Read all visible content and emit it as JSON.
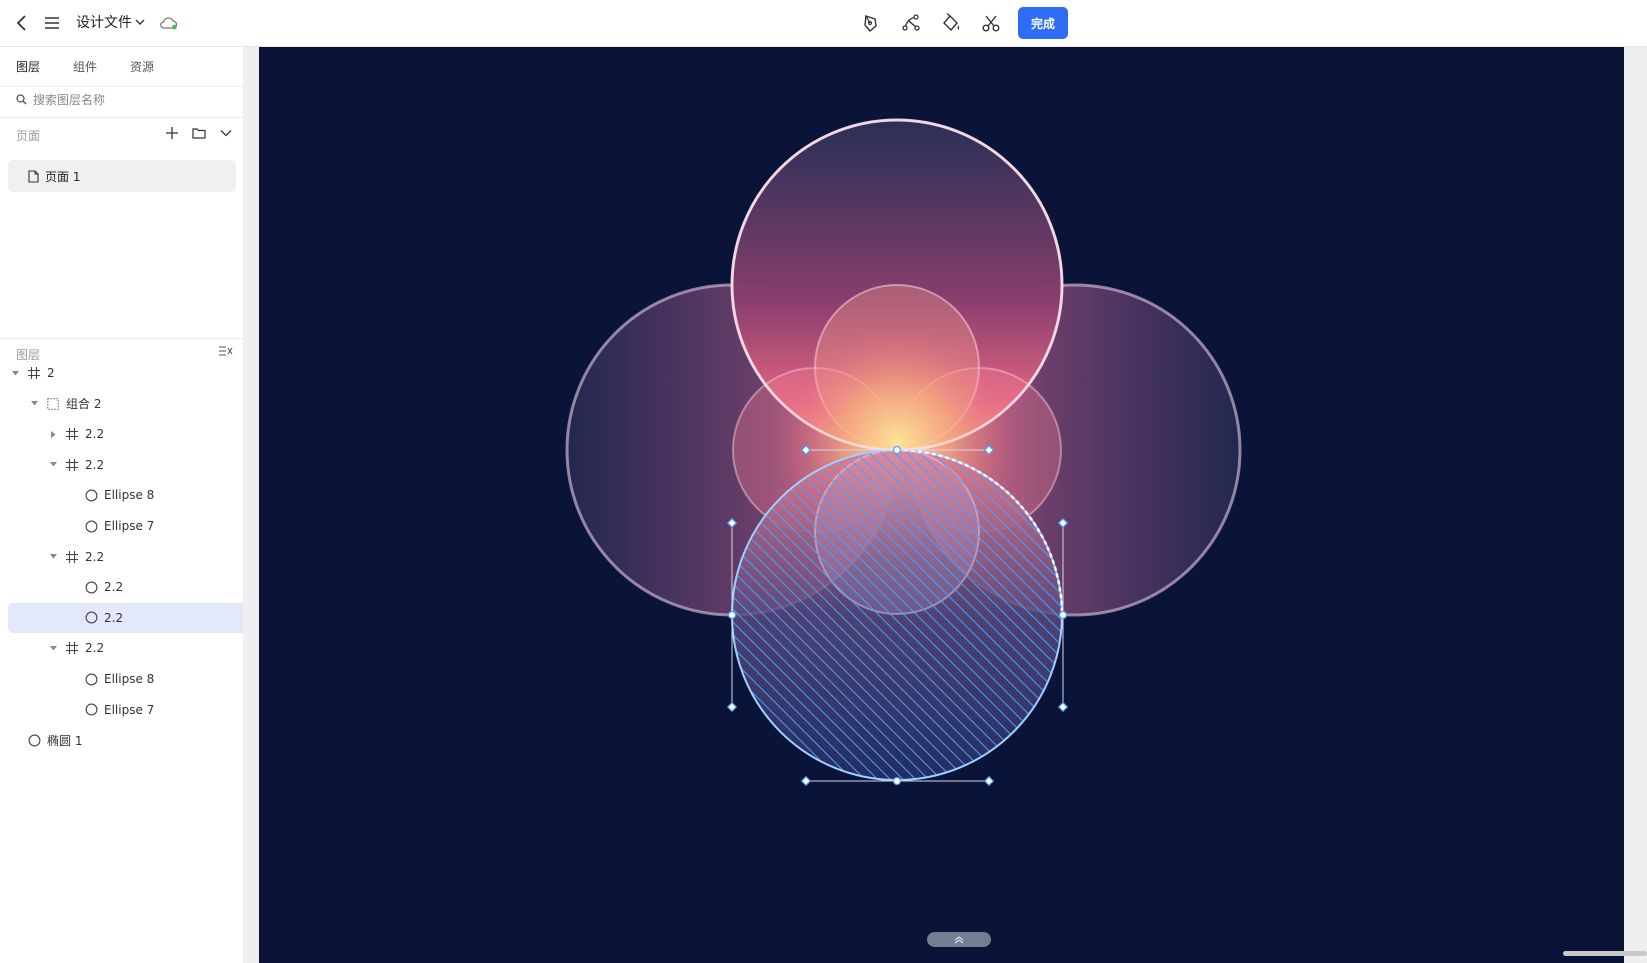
{
  "header": {
    "file_title": "设计文件",
    "done_label": "完成",
    "icons": [
      "back-arrow-icon",
      "menu-icon",
      "chevron-down-icon",
      "cloud-sync-icon",
      "pen-tool-icon",
      "vector-path-icon",
      "paint-bucket-icon",
      "scissors-icon"
    ]
  },
  "sidebar": {
    "tabs": [
      {
        "label": "图层"
      },
      {
        "label": "组件"
      },
      {
        "label": "资源"
      }
    ],
    "search_placeholder": "搜索图层名称",
    "pages_label": "页面",
    "pages": [
      {
        "label": "页面 1"
      }
    ],
    "layers_label": "图层",
    "layers": [
      {
        "label": "2",
        "icon": "frame",
        "depth": 0,
        "caret": "down"
      },
      {
        "label": "组合 2",
        "icon": "group",
        "depth": 1,
        "caret": "down"
      },
      {
        "label": "2.2",
        "icon": "frame",
        "depth": 2,
        "caret": "right"
      },
      {
        "label": "2.2",
        "icon": "frame",
        "depth": 2,
        "caret": "down"
      },
      {
        "label": "Ellipse 8",
        "icon": "ellipse",
        "depth": 3,
        "caret": "none"
      },
      {
        "label": "Ellipse 7",
        "icon": "ellipse",
        "depth": 3,
        "caret": "none"
      },
      {
        "label": "2.2",
        "icon": "frame",
        "depth": 2,
        "caret": "down"
      },
      {
        "label": "2.2",
        "icon": "ellipse",
        "depth": 3,
        "caret": "none"
      },
      {
        "label": "2.2",
        "icon": "ellipse",
        "depth": 3,
        "caret": "none",
        "selected": true
      },
      {
        "label": "2.2",
        "icon": "frame",
        "depth": 2,
        "caret": "down"
      },
      {
        "label": "Ellipse 8",
        "icon": "ellipse",
        "depth": 3,
        "caret": "none"
      },
      {
        "label": "Ellipse 7",
        "icon": "ellipse",
        "depth": 3,
        "caret": "none"
      },
      {
        "label": "椭圆 1",
        "icon": "ellipse",
        "depth": 0,
        "caret": "none"
      }
    ]
  },
  "colors": {
    "accent": "#2e6cf6",
    "canvas_bg": "#0a1438",
    "selection": "#e3e9fb",
    "handle": "#4aa3ff"
  }
}
